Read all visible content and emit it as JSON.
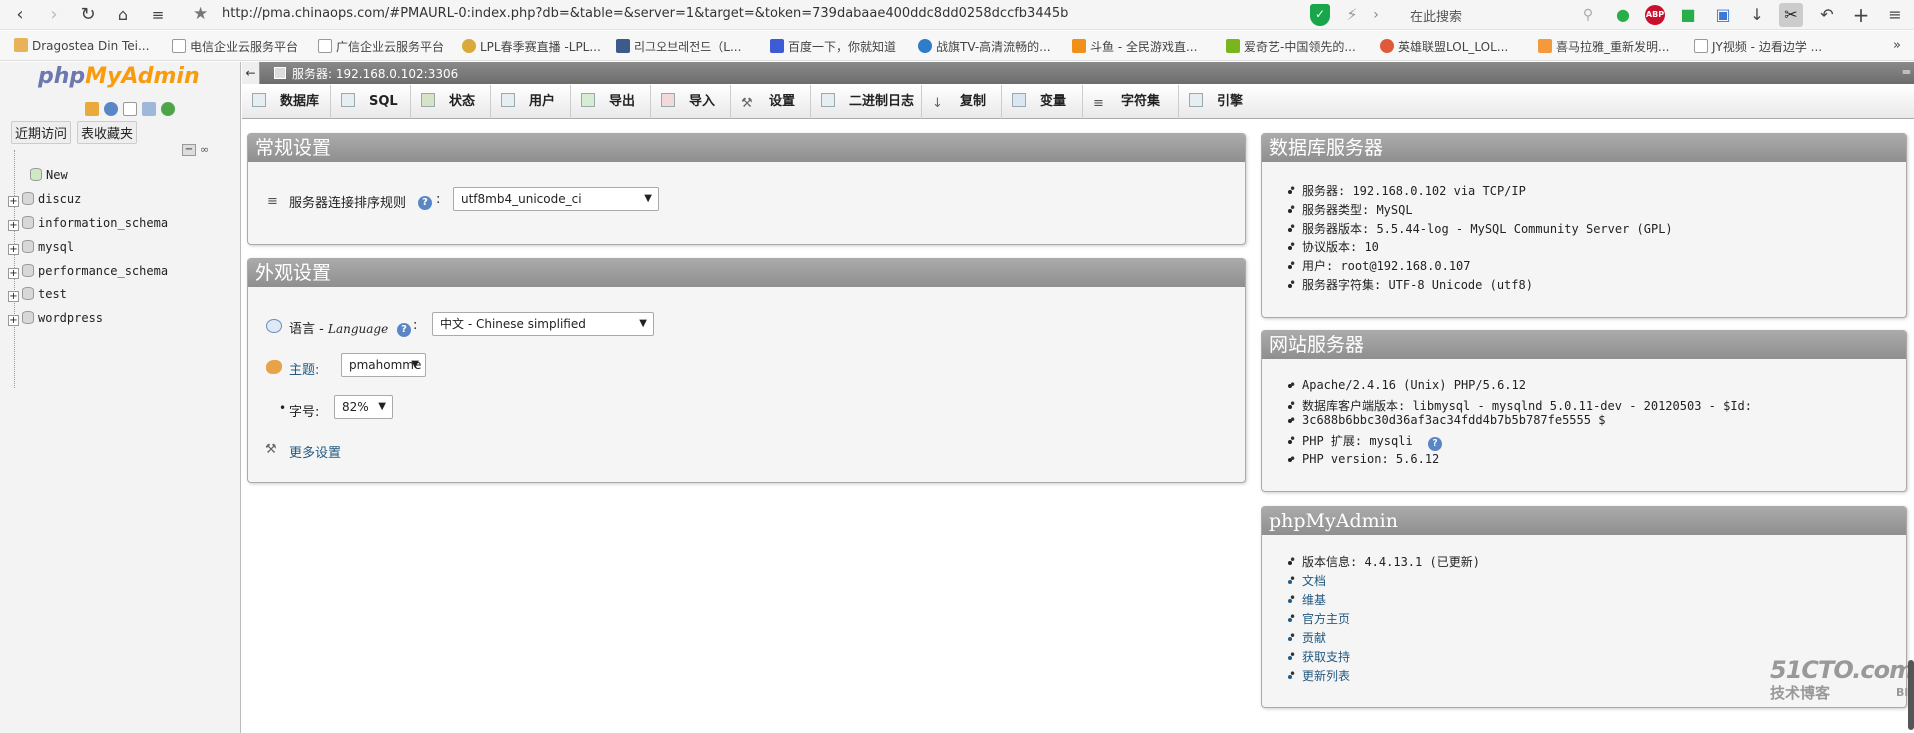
{
  "browser": {
    "url": "http://pma.chinaops.com/#PMAURL-0:index.php?db=&table=&server=1&target=&token=739dabaae400ddc8dd0258dccfb3445b",
    "search_placeholder": "在此搜索",
    "bookmarks": [
      "Dragostea Din Tei...",
      "电信企业云服务平台",
      "广信企业云服务平台",
      "LPL春季赛直播 -LPL...",
      "리그오브레전드（L...",
      "百度一下，你就知道",
      "战旗TV-高清流畅的...",
      "斗鱼 - 全民游戏直...",
      "爱奇艺-中国领先的...",
      "英雄联盟LOL_LOL...",
      "喜马拉雅_重新发明...",
      "JY视频 - 边看边学 ..."
    ]
  },
  "sidebar": {
    "logo_php": "php",
    "logo_myadmin": "MyAdmin",
    "recent_tab": "近期访问",
    "favorites_tab": "表收藏夹",
    "new_label": "New",
    "databases": [
      "discuz",
      "information_schema",
      "mysql",
      "performance_schema",
      "test",
      "wordpress"
    ]
  },
  "serverbar": {
    "label": "服务器: 192.168.0.102:3306"
  },
  "tabs": [
    "数据库",
    "SQL",
    "状态",
    "用户",
    "导出",
    "导入",
    "设置",
    "二进制日志",
    "复制",
    "变量",
    "字符集",
    "引擎"
  ],
  "general": {
    "title": "常规设置",
    "collation_label": "服务器连接排序规则",
    "collation_value": "utf8mb4_unicode_ci"
  },
  "appearance": {
    "title": "外观设置",
    "language_label": "语言 - ",
    "language_label_en": "Language",
    "language_value": "中文 - Chinese simplified",
    "theme_label": "主题:",
    "theme_value": "pmahomme",
    "fontsize_label": "字号:",
    "fontsize_value": "82%",
    "more_settings": "更多设置"
  },
  "db_server": {
    "title": "数据库服务器",
    "items": [
      "服务器: 192.168.0.102 via TCP/IP",
      "服务器类型: MySQL",
      "服务器版本: 5.5.44-log - MySQL Community Server (GPL)",
      "协议版本: 10",
      "用户: root@192.168.0.107",
      "服务器字符集: UTF-8 Unicode (utf8)"
    ]
  },
  "web_server": {
    "title": "网站服务器",
    "items": [
      "Apache/2.4.16 (Unix) PHP/5.6.12",
      "数据库客户端版本: libmysql - mysqlnd 5.0.11-dev - 20120503 - $Id:",
      "3c688b6bbc30d36af3ac34fdd4b7b5b787fe5555 $",
      "PHP 扩展: mysqli",
      "PHP version: 5.6.12"
    ]
  },
  "pma": {
    "title": "phpMyAdmin",
    "version": "版本信息: 4.4.13.1 (已更新)",
    "links": [
      "文档",
      "维基",
      "官方主页",
      "贡献",
      "获取支持",
      "更新列表"
    ]
  },
  "watermark": {
    "site": "51CTO.com",
    "sub": "技术博客",
    "blog": "Blog"
  },
  "colors": {
    "panel_header": "#999999",
    "link": "#235a81",
    "logo_php": "#6c78af",
    "logo_myadmin": "#f89c0e"
  }
}
